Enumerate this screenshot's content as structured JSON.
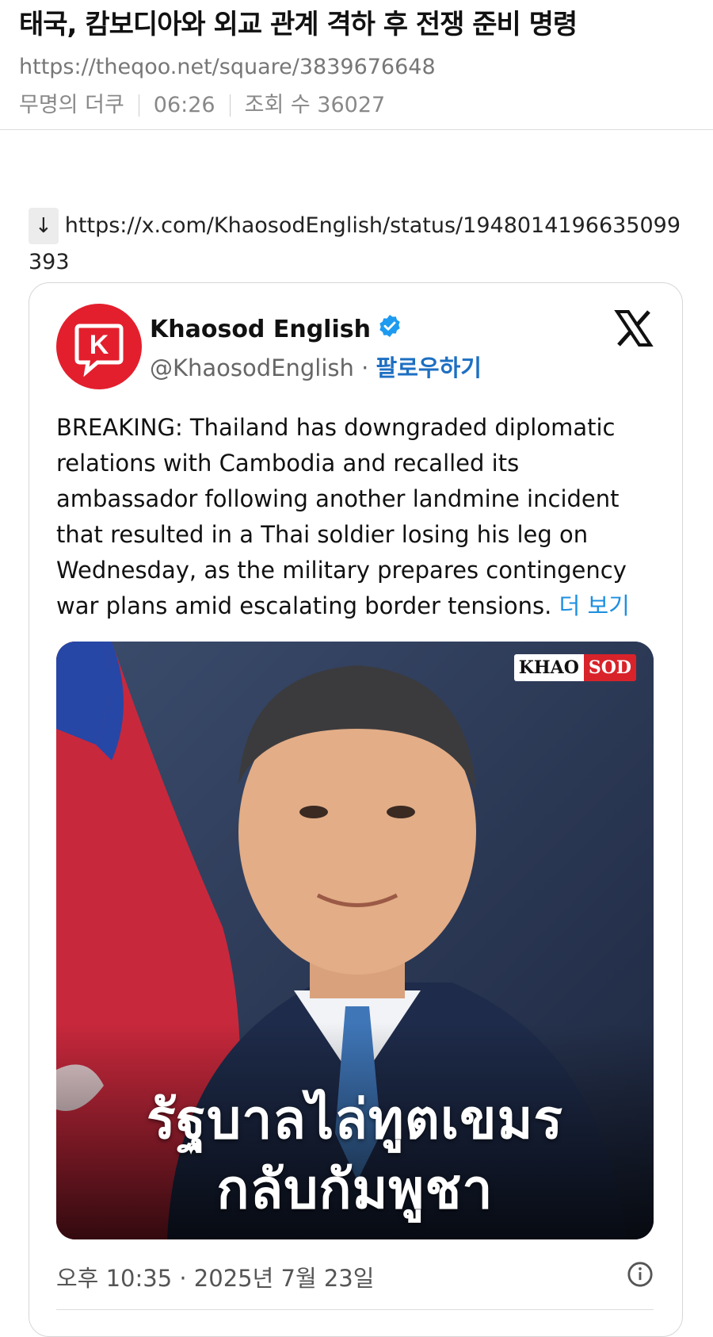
{
  "post": {
    "title": "태국, 캄보디아와 외교 관계 격하 후 전쟁 준비 명령",
    "url": "https://theqoo.net/square/3839676648",
    "author": "무명의 더쿠",
    "time": "06:26",
    "views": "조회 수 36027"
  },
  "content": {
    "arrow": "↓",
    "link": "https://x.com/KhaosodEnglish/status/1948014196635099393"
  },
  "tweet": {
    "name": "Khaosod English",
    "handle": "@KhaosodEnglish",
    "dot": " · ",
    "follow": "팔로우하기",
    "text": "BREAKING: Thailand has downgraded diplomatic relations with Cambodia and recalled its ambassador following another landmine incident that resulted in a Thai soldier losing his leg on Wednesday, as the military prepares contingency war plans amid escalating border tensions.",
    "more": "더 보기",
    "image": {
      "badge_left": "KHAO",
      "badge_right": "SOD",
      "caption_line1": "รัฐบาลไล่ทูตเขมร",
      "caption_line2": "กลับกัมพูชา"
    },
    "timestamp": "오후 10:35 · 2025년 7월 23일",
    "avatar_letter": "K"
  },
  "colors": {
    "brand_red": "#e31f2d",
    "link_blue": "#1d6fc2",
    "verified_blue": "#1d9bf0"
  }
}
